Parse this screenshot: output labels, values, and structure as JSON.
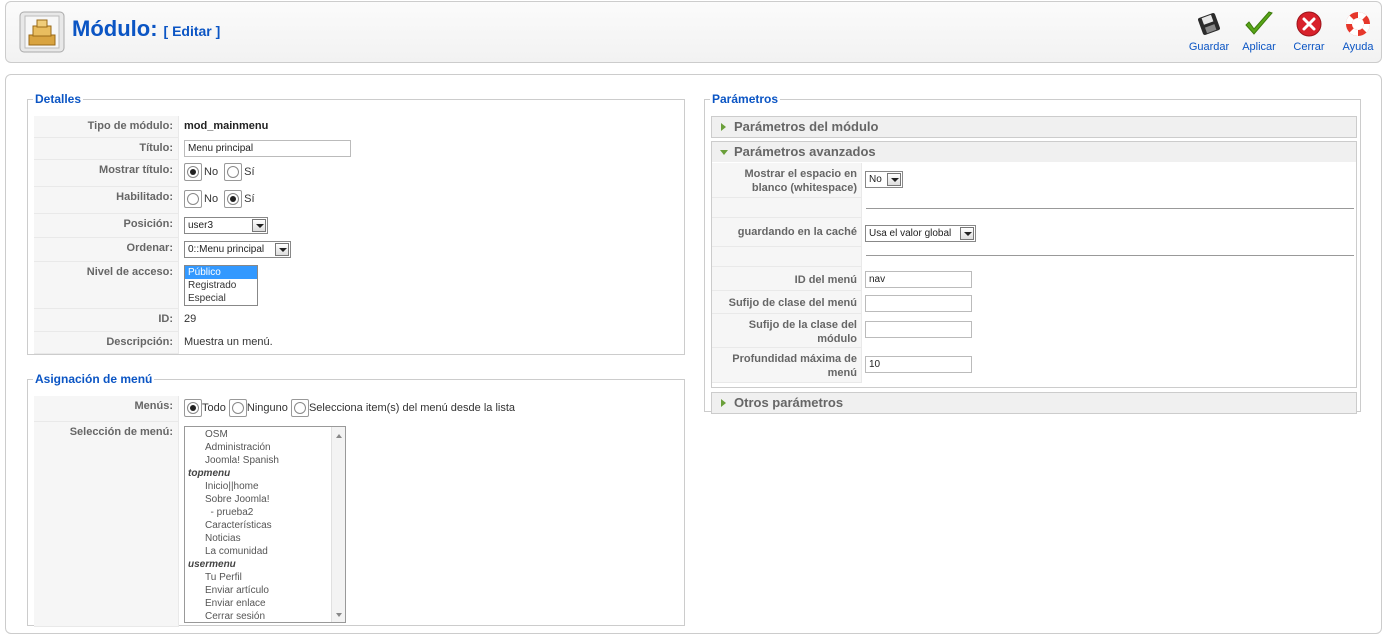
{
  "toolbar": {
    "title": "Módulo:",
    "subtitle": "[ Editar ]",
    "buttons": {
      "save": "Guardar",
      "apply": "Aplicar",
      "close": "Cerrar",
      "help": "Ayuda"
    }
  },
  "details": {
    "legend": "Detalles",
    "module_type_label": "Tipo de módulo:",
    "module_type": "mod_mainmenu",
    "title_label": "Título:",
    "title_value": "Menu principal",
    "show_title_label": "Mostrar título:",
    "no": "No",
    "yes": "Sí",
    "enabled_label": "Habilitado:",
    "position_label": "Posición:",
    "position_value": "user3",
    "order_label": "Ordenar:",
    "order_value": "0::Menu principal",
    "access_label": "Nivel de acceso:",
    "access_options": [
      "Público",
      "Registrado",
      "Especial"
    ],
    "id_label": "ID:",
    "id_value": "29",
    "description_label": "Descripción:",
    "description_value": "Muestra un menú."
  },
  "menu_assignment": {
    "legend": "Asignación de menú",
    "menus_label": "Menús:",
    "opt_all": "Todo",
    "opt_none": "Ninguno",
    "opt_select": "Selecciona item(s) del menú desde la lista",
    "selection_label": "Selección de menú:",
    "items": [
      {
        "type": "item",
        "text": "OSM"
      },
      {
        "type": "item",
        "text": "Administración"
      },
      {
        "type": "item",
        "text": "Joomla! Spanish"
      },
      {
        "type": "group",
        "text": "topmenu"
      },
      {
        "type": "item",
        "text": "Inicio||home"
      },
      {
        "type": "item",
        "text": "Sobre Joomla!"
      },
      {
        "type": "item",
        "text": "  - prueba2"
      },
      {
        "type": "item",
        "text": "Características"
      },
      {
        "type": "item",
        "text": "Noticias"
      },
      {
        "type": "item",
        "text": "La comunidad"
      },
      {
        "type": "group",
        "text": "usermenu"
      },
      {
        "type": "item",
        "text": "Tu Perfil"
      },
      {
        "type": "item",
        "text": "Enviar artículo"
      },
      {
        "type": "item",
        "text": "Enviar enlace"
      },
      {
        "type": "item",
        "text": "Cerrar sesión"
      }
    ]
  },
  "parameters": {
    "legend": "Parámetros",
    "module_params": "Parámetros del módulo",
    "advanced_params": "Parámetros avanzados",
    "whitespace_label": "Mostrar el espacio en blanco (whitespace)",
    "whitespace_value": "No",
    "cache_label": "guardando en la caché",
    "cache_value": "Usa el valor global",
    "menu_id_label": "ID del menú",
    "menu_id_value": "nav",
    "menu_class_label": "Sufijo de clase del menú",
    "menu_class_value": "",
    "module_class_label": "Sufijo de la clase del módulo",
    "module_class_value": "",
    "max_depth_label": "Profundidad máxima de menú",
    "max_depth_value": "10",
    "other_params": "Otros parámetros"
  }
}
